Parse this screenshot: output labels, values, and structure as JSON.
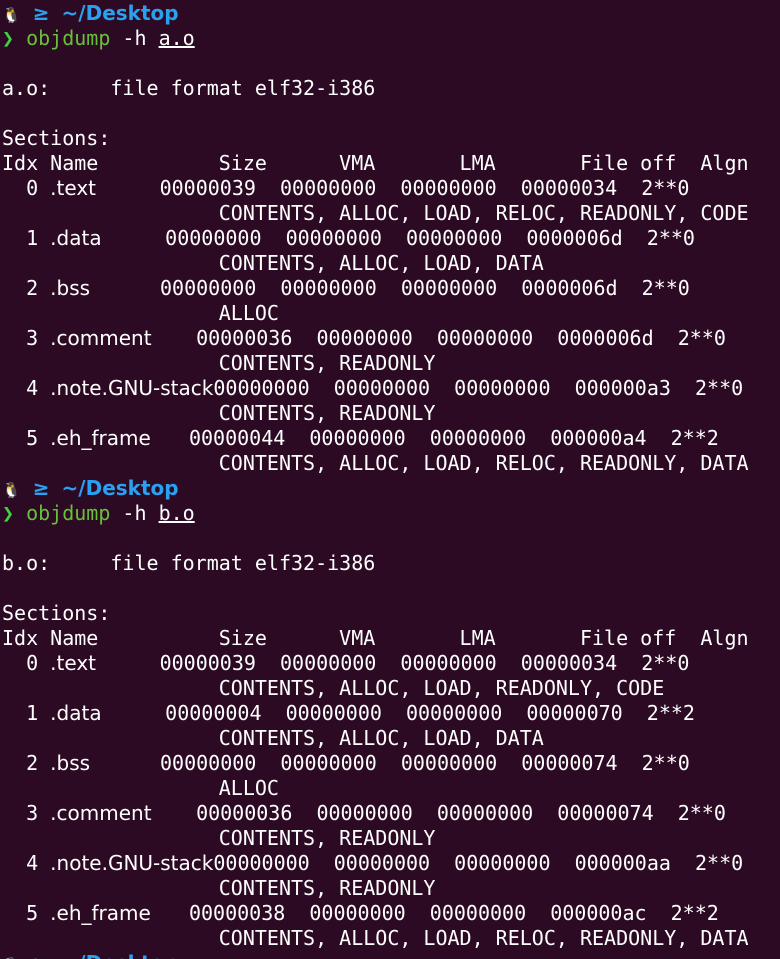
{
  "prompts": [
    {
      "path": "~/Desktop",
      "command": "objdump",
      "flag": "-h",
      "file": "a.o"
    },
    {
      "path": "~/Desktop",
      "command": "objdump",
      "flag": "-h",
      "file": "b.o"
    }
  ],
  "outputs": [
    {
      "file_line": "a.o:     file format elf32-i386",
      "sections_label": "Sections:",
      "header": "Idx Name          Size      VMA       LMA       File off  Algn",
      "rows": [
        {
          "idx": "0",
          "name": ".text",
          "size": "00000039",
          "vma": "00000000",
          "lma": "00000000",
          "off": "00000034",
          "algn": "2**0",
          "flags": "CONTENTS, ALLOC, LOAD, RELOC, READONLY, CODE"
        },
        {
          "idx": "1",
          "name": ".data",
          "size": "00000000",
          "vma": "00000000",
          "lma": "00000000",
          "off": "0000006d",
          "algn": "2**0",
          "flags": "CONTENTS, ALLOC, LOAD, DATA"
        },
        {
          "idx": "2",
          "name": ".bss",
          "size": "00000000",
          "vma": "00000000",
          "lma": "00000000",
          "off": "0000006d",
          "algn": "2**0",
          "flags": "ALLOC"
        },
        {
          "idx": "3",
          "name": ".comment",
          "size": "00000036",
          "vma": "00000000",
          "lma": "00000000",
          "off": "0000006d",
          "algn": "2**0",
          "flags": "CONTENTS, READONLY"
        },
        {
          "idx": "4",
          "name": ".note.GNU-stack",
          "size": "00000000",
          "vma": "00000000",
          "lma": "00000000",
          "off": "000000a3",
          "algn": "2**0",
          "flags": "CONTENTS, READONLY"
        },
        {
          "idx": "5",
          "name": ".eh_frame",
          "size": "00000044",
          "vma": "00000000",
          "lma": "00000000",
          "off": "000000a4",
          "algn": "2**2",
          "flags": "CONTENTS, ALLOC, LOAD, RELOC, READONLY, DATA"
        }
      ]
    },
    {
      "file_line": "b.o:     file format elf32-i386",
      "sections_label": "Sections:",
      "header": "Idx Name          Size      VMA       LMA       File off  Algn",
      "rows": [
        {
          "idx": "0",
          "name": ".text",
          "size": "00000039",
          "vma": "00000000",
          "lma": "00000000",
          "off": "00000034",
          "algn": "2**0",
          "flags": "CONTENTS, ALLOC, LOAD, READONLY, CODE"
        },
        {
          "idx": "1",
          "name": ".data",
          "size": "00000004",
          "vma": "00000000",
          "lma": "00000000",
          "off": "00000070",
          "algn": "2**2",
          "flags": "CONTENTS, ALLOC, LOAD, DATA"
        },
        {
          "idx": "2",
          "name": ".bss",
          "size": "00000000",
          "vma": "00000000",
          "lma": "00000000",
          "off": "00000074",
          "algn": "2**0",
          "flags": "ALLOC"
        },
        {
          "idx": "3",
          "name": ".comment",
          "size": "00000036",
          "vma": "00000000",
          "lma": "00000000",
          "off": "00000074",
          "algn": "2**0",
          "flags": "CONTENTS, READONLY"
        },
        {
          "idx": "4",
          "name": ".note.GNU-stack",
          "size": "00000000",
          "vma": "00000000",
          "lma": "00000000",
          "off": "000000aa",
          "algn": "2**0",
          "flags": "CONTENTS, READONLY"
        },
        {
          "idx": "5",
          "name": ".eh_frame",
          "size": "00000038",
          "vma": "00000000",
          "lma": "00000000",
          "off": "000000ac",
          "algn": "2**2",
          "flags": "CONTENTS, ALLOC, LOAD, RELOC, READONLY, DATA"
        }
      ]
    }
  ],
  "trailing_prompt": {
    "path": "~/Desktop"
  },
  "colors": {
    "background": "#2c0a23",
    "path": "#2aa0f0",
    "arrow": "#3fd13f",
    "command": "#67c03a",
    "text": "#ffffff"
  },
  "icons": {
    "tux": "tux-icon",
    "folder": "folder-icon",
    "arrow": "prompt-arrow-icon"
  }
}
